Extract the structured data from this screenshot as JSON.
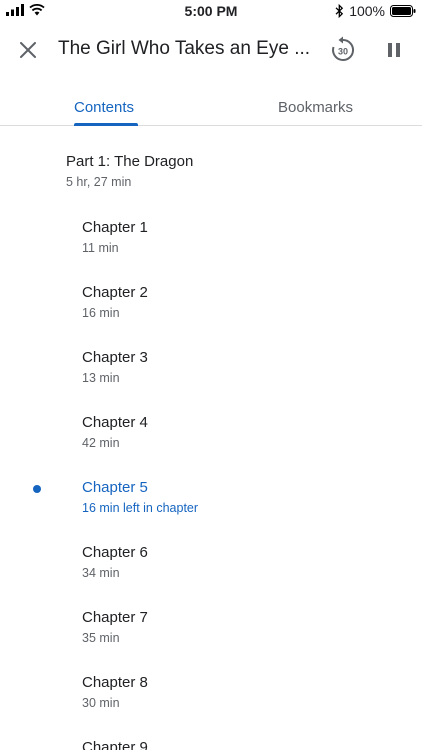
{
  "status_bar": {
    "time": "5:00 PM",
    "battery": "100%"
  },
  "app_bar": {
    "title": "The Girl Who Takes an Eye ...",
    "replay_seconds": "30"
  },
  "tabs": [
    {
      "label": "Contents",
      "selected": true
    },
    {
      "label": "Bookmarks",
      "selected": false
    }
  ],
  "part": {
    "title": "Part 1: The Dragon",
    "duration": "5 hr, 27 min"
  },
  "chapters": [
    {
      "title": "Chapter 1",
      "duration": "11 min"
    },
    {
      "title": "Chapter 2",
      "duration": "16 min"
    },
    {
      "title": "Chapter 3",
      "duration": "13 min"
    },
    {
      "title": "Chapter 4",
      "duration": "42 min"
    },
    {
      "title": "Chapter 5",
      "duration": "16 min left in chapter",
      "current": true
    },
    {
      "title": "Chapter 6",
      "duration": "34 min"
    },
    {
      "title": "Chapter 7",
      "duration": "35 min"
    },
    {
      "title": "Chapter 8",
      "duration": "30 min"
    },
    {
      "title": "Chapter 9",
      "duration": ""
    }
  ],
  "colors": {
    "accent": "#1565c0",
    "text_primary": "#202124",
    "text_secondary": "#5f6368",
    "divider": "#dadce0"
  },
  "icons": {
    "close": "close-icon",
    "replay": "replay-30-icon",
    "pause": "pause-icon",
    "signal": "signal-icon",
    "wifi": "wifi-icon",
    "bluetooth": "bluetooth-icon",
    "battery": "battery-icon"
  }
}
